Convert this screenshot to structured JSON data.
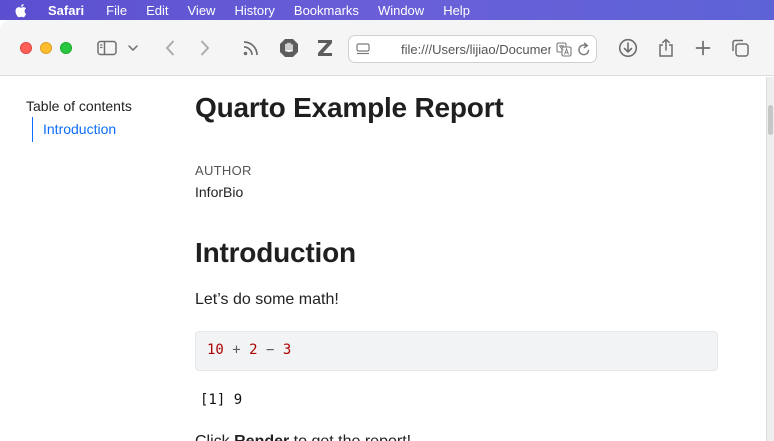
{
  "menubar": {
    "app": "Safari",
    "items": [
      "File",
      "Edit",
      "View",
      "History",
      "Bookmarks",
      "Window",
      "Help"
    ]
  },
  "toolbar": {
    "icons": [
      "sidebar-icon",
      "chevron-down-icon",
      "back-icon",
      "forward-icon",
      "rss-icon",
      "shield-extension-icon",
      "zotero-icon",
      "download-icon",
      "share-icon",
      "new-tab-icon",
      "tab-overview-icon"
    ],
    "address": {
      "url": "file:///Users/lijiao/Documents"
    }
  },
  "toc": {
    "title": "Table of contents",
    "items": [
      {
        "label": "Introduction",
        "active": true
      }
    ]
  },
  "document": {
    "title": "Quarto Example Report",
    "author_label": "AUTHOR",
    "author": "InforBio",
    "section_heading": "Introduction",
    "paragraph1": "Let’s do some math!",
    "code": {
      "a": "10",
      "op1": "+",
      "b": "2",
      "op2": "−",
      "c": "3"
    },
    "output": "[1] 9",
    "paragraph2": {
      "before": "Click ",
      "bold": "Render",
      "after": " to get the report!"
    }
  },
  "colors": {
    "menubar": "#5b4fd0",
    "link": "#0d6efd",
    "code_number": "#ad0000",
    "code_bg": "#f1f3f5"
  }
}
